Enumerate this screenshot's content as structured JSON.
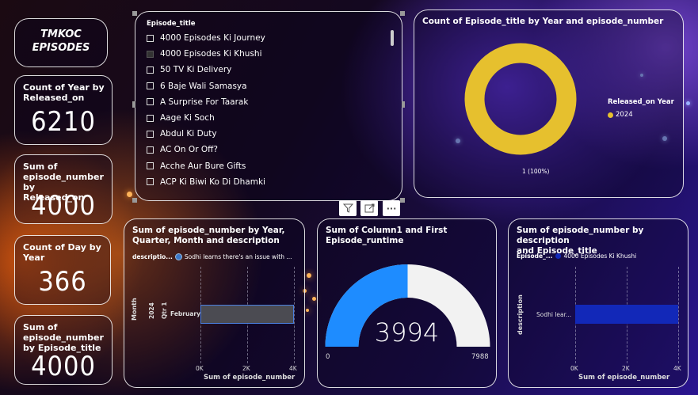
{
  "logo": {
    "line1": "TMKOC",
    "line2": "EPISODES"
  },
  "kpis": [
    {
      "title": "Count of Year by Released_on",
      "value": "6210"
    },
    {
      "title": "Sum of episode_number by Released_on",
      "value": "4000"
    },
    {
      "title": "Count of Day by Year",
      "value": "366"
    },
    {
      "title": "Sum of episode_number by Episode_title",
      "value": "4000"
    }
  ],
  "slicer": {
    "header": "Episode_title",
    "items": [
      {
        "label": "4000 Episodes Ki Journey",
        "checked": false
      },
      {
        "label": "4000 Episodes Ki Khushi",
        "checked": true
      },
      {
        "label": "50 TV Ki Delivery",
        "checked": false
      },
      {
        "label": "6 Baje Wali Samasya",
        "checked": false
      },
      {
        "label": "A Surprise For Taarak",
        "checked": false
      },
      {
        "label": "Aage Ki Soch",
        "checked": false
      },
      {
        "label": "Abdul Ki Duty",
        "checked": false
      },
      {
        "label": "AC On Or Off?",
        "checked": false
      },
      {
        "label": "Acche Aur Bure Gifts",
        "checked": false
      },
      {
        "label": "ACP Ki Biwi Ko Di Dhamki",
        "checked": false
      }
    ]
  },
  "toolbar": {
    "filter_icon": "funnel-icon",
    "focus_icon": "focus-mode-icon",
    "more_label": "···"
  },
  "donut": {
    "title": "Count of Episode_title by Year and episode_number",
    "legend_title": "Released_on Year",
    "legend_item": "2024",
    "data_label": "1 (100%)",
    "color": "#e6c02e"
  },
  "bar1": {
    "title_l1": "Sum of episode_number by Year,",
    "title_l2": "Quarter, Month and description",
    "legend_key": "descriptio...",
    "legend_item": "Sodhi learns there's an issue with ...",
    "axis_title_y": "Month",
    "year": "2024",
    "quarter": "Qtr 1",
    "category": "February",
    "ticks": [
      "0K",
      "2K",
      "4K"
    ],
    "axis_title_x": "Sum of episode_number",
    "bar_color": "#4b4b52"
  },
  "gauge": {
    "title_l1": "Sum of Column1 and First",
    "title_l2": "Episode_runtime",
    "value_label": "3994",
    "min_label": "0",
    "max_label": "7988",
    "fill_color": "#1e8cff"
  },
  "bar2": {
    "title_l1": "Sum of episode_number by description",
    "title_l2": "and Episode_title",
    "legend_key": "Episode_...",
    "legend_item": "4000 Episodes Ki Khushi",
    "axis_title_y": "description",
    "category": "Sodhi lear...",
    "ticks": [
      "0K",
      "2K",
      "4K"
    ],
    "axis_title_x": "Sum of episode_number",
    "bar_color": "#1228b8"
  },
  "chart_data": [
    {
      "type": "pie",
      "title": "Count of Episode_title by Year and episode_number",
      "categories": [
        "2024"
      ],
      "values": [
        1
      ],
      "legend": "right"
    },
    {
      "type": "bar",
      "title": "Sum of episode_number by Year, Quarter, Month and description",
      "categories": [
        "February"
      ],
      "series": [
        {
          "name": "Sodhi learns there's an issue with ...",
          "values": [
            4000
          ]
        }
      ],
      "xlabel": "Sum of episode_number",
      "ylabel": "Month",
      "xlim": [
        0,
        4000
      ]
    },
    {
      "type": "gauge",
      "title": "Sum of Column1 and First Episode_runtime",
      "value": 3994,
      "min": 0,
      "max": 7988
    },
    {
      "type": "bar",
      "title": "Sum of episode_number by description and Episode_title",
      "categories": [
        "Sodhi lear..."
      ],
      "series": [
        {
          "name": "4000 Episodes Ki Khushi",
          "values": [
            4000
          ]
        }
      ],
      "xlabel": "Sum of episode_number",
      "ylabel": "description",
      "xlim": [
        0,
        4000
      ]
    }
  ]
}
